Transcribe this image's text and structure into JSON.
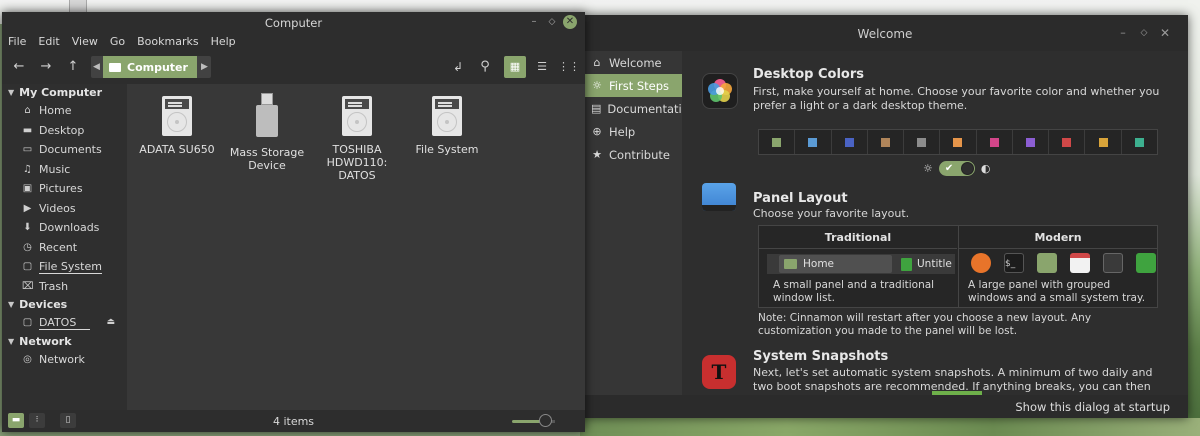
{
  "desktop": {},
  "welcome": {
    "title": "Welcome",
    "nav": [
      {
        "label": "Welcome",
        "icon": "house-icon"
      },
      {
        "label": "First Steps",
        "icon": "lightbulb-icon"
      },
      {
        "label": "Documentation",
        "icon": "book-icon"
      },
      {
        "label": "Help",
        "icon": "lifebuoy-icon"
      },
      {
        "label": "Contribute",
        "icon": "star-icon"
      }
    ],
    "active_nav": "First Steps",
    "desktop_colors": {
      "title": "Desktop Colors",
      "text": "First, make yourself at home. Choose your favorite color and whether you prefer a light or a dark desktop theme.",
      "swatches": [
        "#8aa56d",
        "#5b9bd5",
        "#4a63c4",
        "#b0855a",
        "#8c8c8c",
        "#e6954a",
        "#d3468a",
        "#8c5ed3",
        "#d04848",
        "#d9a43a",
        "#3db08f"
      ],
      "dark_theme": true
    },
    "panel_layout": {
      "title": "Panel Layout",
      "text": "Choose your favorite layout.",
      "traditional": {
        "heading": "Traditional",
        "button_label": "Home",
        "window_label": "Untitle",
        "desc": "A small panel and a traditional window list."
      },
      "modern": {
        "heading": "Modern",
        "desc": "A large panel with grouped windows and a small system tray."
      },
      "note": "Note: Cinnamon will restart after you choose a new layout. Any customization you made to the panel will be lost."
    },
    "snapshots": {
      "title": "System Snapshots",
      "text": "Next, let's set automatic system snapshots. A minimum of two daily and two boot snapshots are recommended. If anything breaks, you can then restore your computer to its previous working state."
    },
    "footer": {
      "show_at_startup": "Show this dialog at startup"
    }
  },
  "files": {
    "title": "Computer",
    "menu": [
      "File",
      "Edit",
      "View",
      "Go",
      "Bookmarks",
      "Help"
    ],
    "location": "Computer",
    "sidebar": {
      "my_computer": {
        "heading": "My Computer",
        "items": [
          {
            "label": "Home",
            "icon": "home-icon"
          },
          {
            "label": "Desktop",
            "icon": "desktop-icon"
          },
          {
            "label": "Documents",
            "icon": "document-icon"
          },
          {
            "label": "Music",
            "icon": "music-icon"
          },
          {
            "label": "Pictures",
            "icon": "picture-icon"
          },
          {
            "label": "Videos",
            "icon": "video-icon"
          },
          {
            "label": "Downloads",
            "icon": "download-icon"
          },
          {
            "label": "Recent",
            "icon": "clock-icon"
          },
          {
            "label": "File System",
            "icon": "drive-icon"
          },
          {
            "label": "Trash",
            "icon": "trash-icon"
          }
        ]
      },
      "devices": {
        "heading": "Devices",
        "items": [
          {
            "label": "DATOS",
            "icon": "drive-icon"
          }
        ]
      },
      "network": {
        "heading": "Network",
        "items": [
          {
            "label": "Network",
            "icon": "network-icon"
          }
        ]
      }
    },
    "items": [
      {
        "label": "ADATA SU650",
        "kind": "drive"
      },
      {
        "label": "Mass Storage Device",
        "kind": "usb"
      },
      {
        "label": "TOSHIBA HDWD110: DATOS",
        "kind": "drive"
      },
      {
        "label": "File System",
        "kind": "drive"
      }
    ],
    "status": {
      "count": "4 items"
    }
  },
  "colors": {
    "accent": "#8aa56d"
  }
}
